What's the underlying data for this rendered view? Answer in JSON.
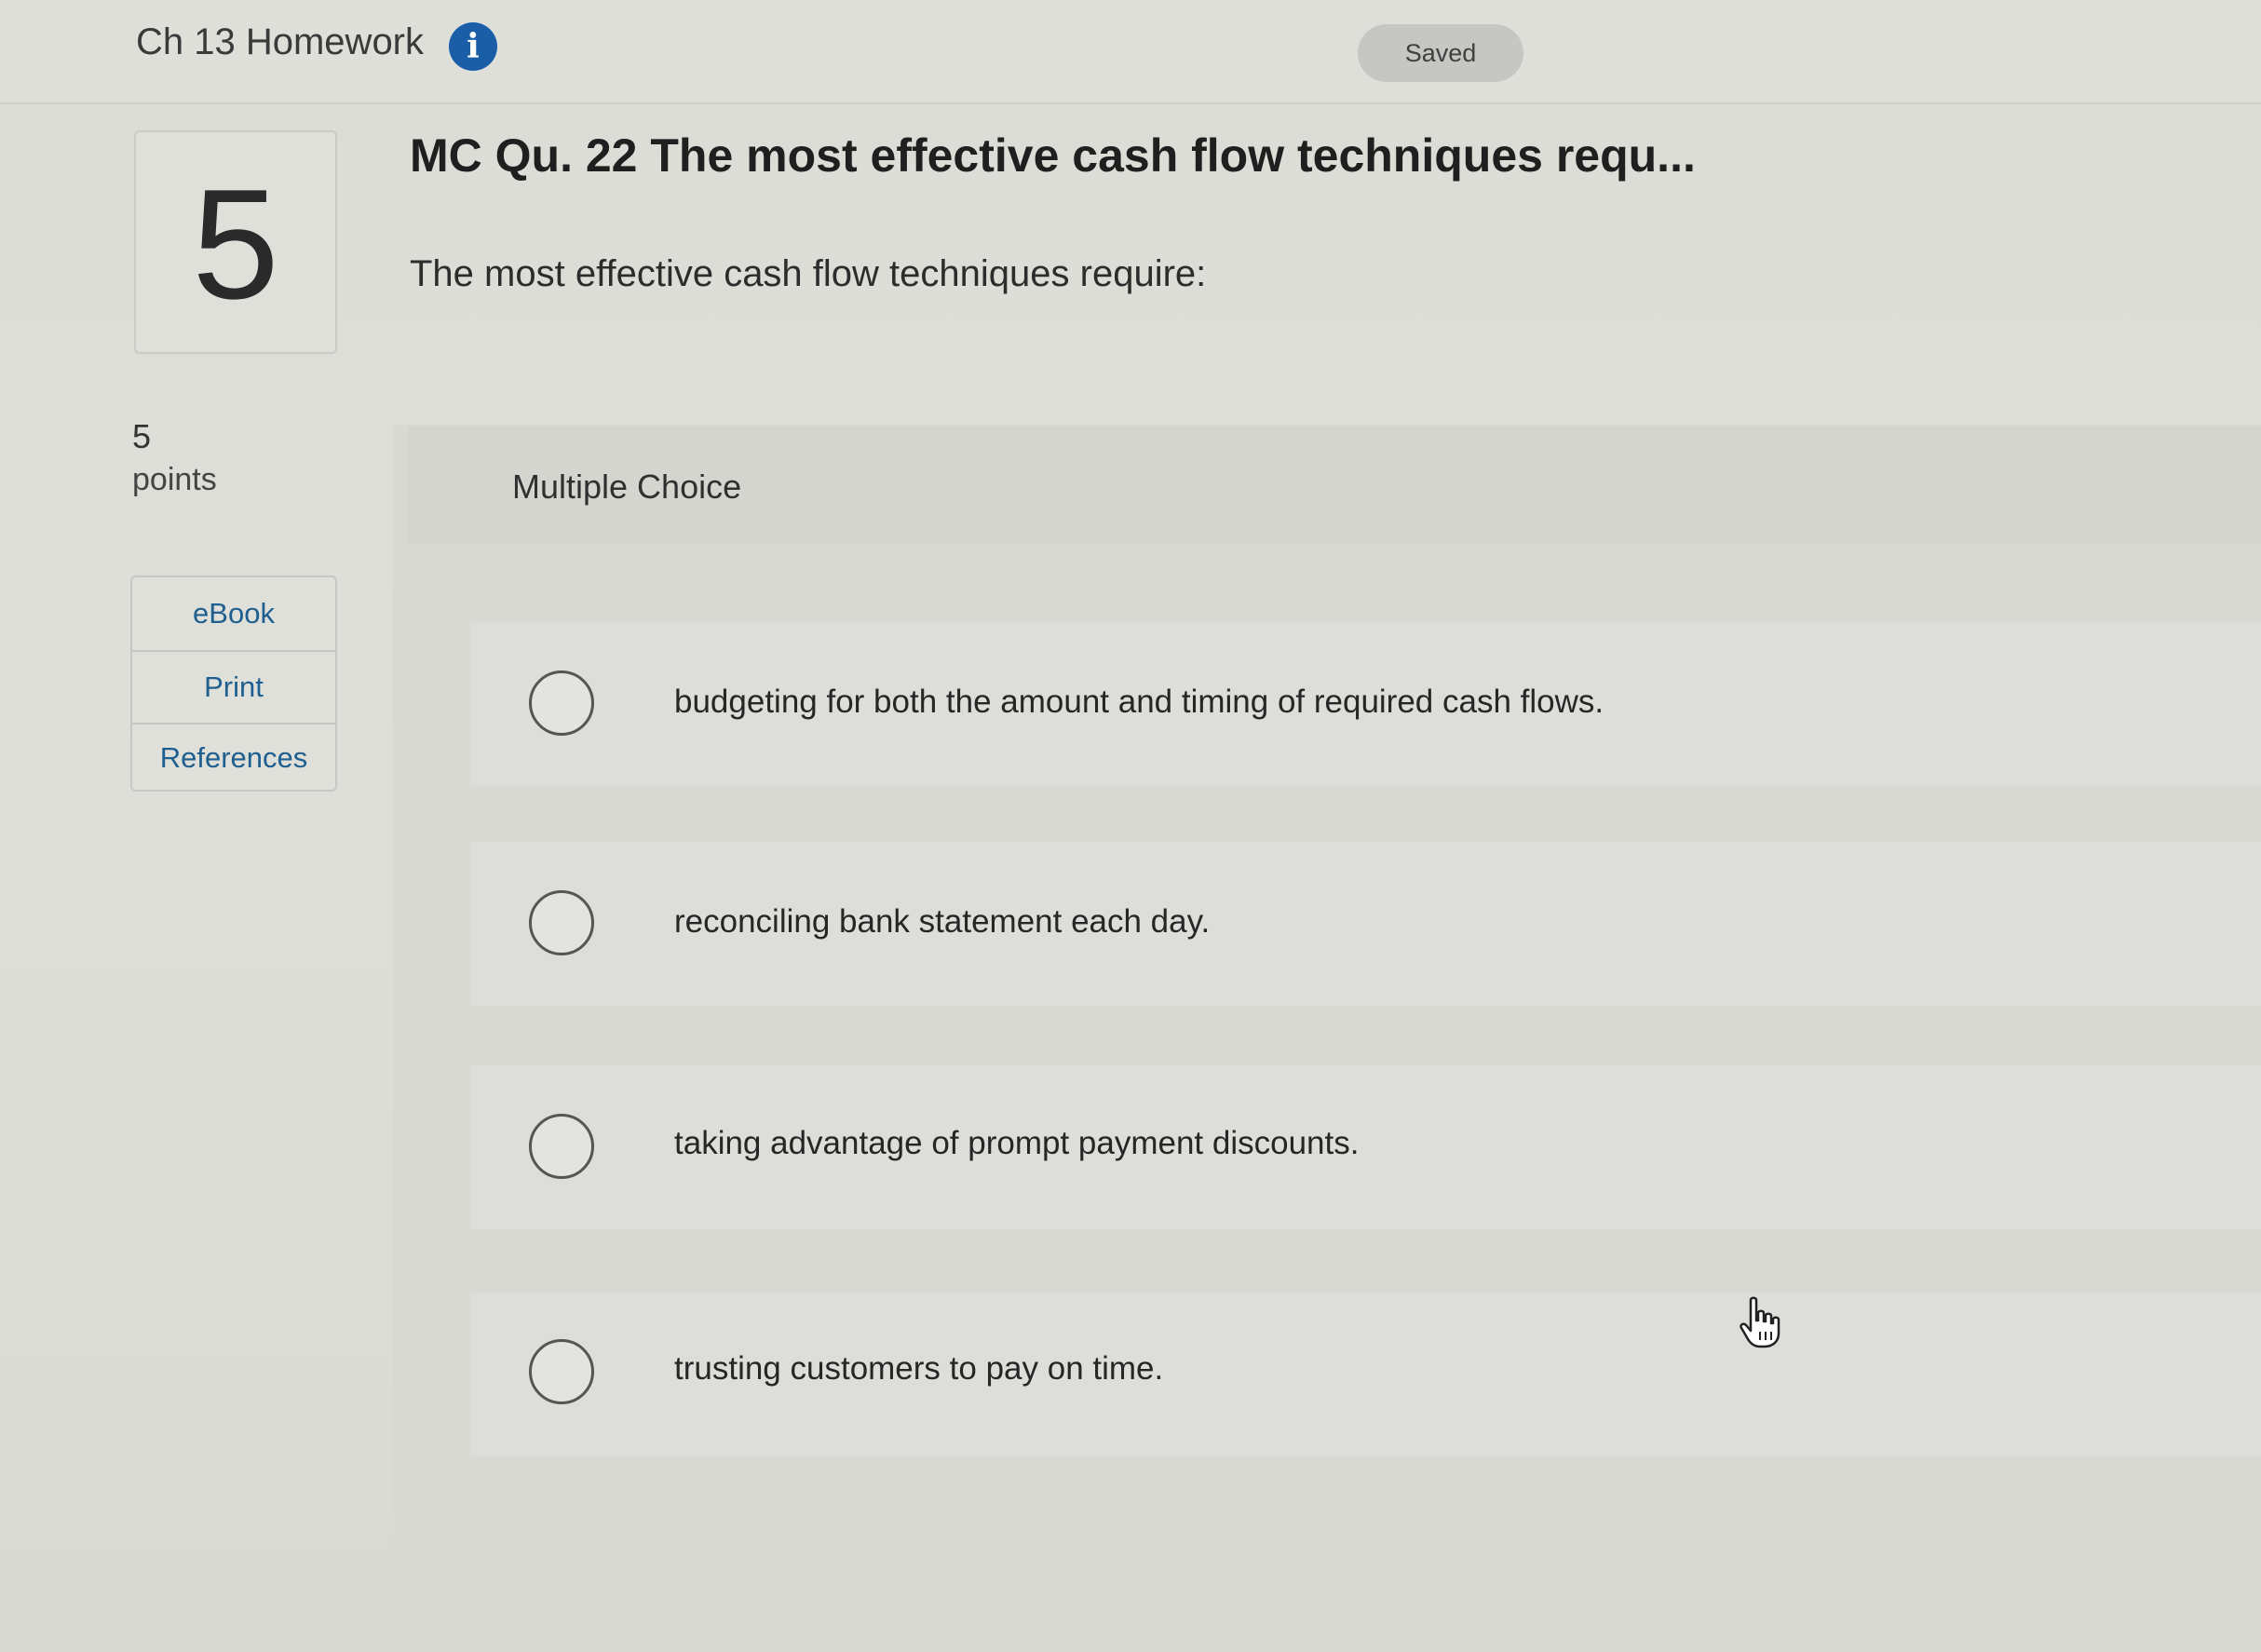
{
  "header": {
    "assignment_title": "Ch 13 Homework",
    "info_icon": "i",
    "save_status": "Saved"
  },
  "question": {
    "number": "5",
    "points_value": "5",
    "points_label": "points",
    "title": "MC Qu. 22 The most effective cash flow techniques requ...",
    "prompt": "The most effective cash flow techniques require:",
    "type_label": "Multiple Choice",
    "choices": [
      "budgeting for both the amount and timing of required cash flows.",
      "reconciling bank statement each day.",
      "taking advantage of prompt payment discounts.",
      "trusting customers to pay on time."
    ],
    "selected_choice": null
  },
  "tools": {
    "ebook": "eBook",
    "print": "Print",
    "references": "References"
  },
  "colors": {
    "info_icon": "#1b5ea8",
    "tool_link": "#1e5f8f",
    "saved_pill": "#c6c7c3"
  },
  "icons": {
    "info": "info-icon",
    "radio": "radio-icon",
    "pointer": "hand-pointer-icon"
  }
}
